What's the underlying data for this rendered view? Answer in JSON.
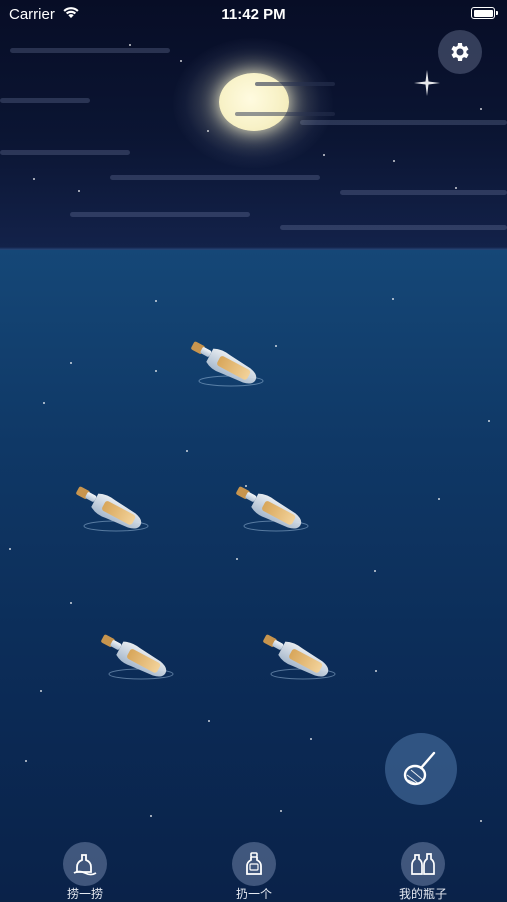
{
  "status_bar": {
    "carrier": "Carrier",
    "time": "11:42 PM"
  },
  "icons": {
    "settings": "gear-icon",
    "net": "fishing-net-icon",
    "bottle": "message-bottle-icon"
  },
  "tabs": [
    {
      "label": "捞一捞",
      "icon": "pick-bottle-icon"
    },
    {
      "label": "扔一个",
      "icon": "throw-bottle-icon"
    },
    {
      "label": "我的瓶子",
      "icon": "my-bottles-icon"
    }
  ],
  "colors": {
    "sky": "#0b1533",
    "sea": "#0f3866",
    "moon": "#fffbe0"
  }
}
